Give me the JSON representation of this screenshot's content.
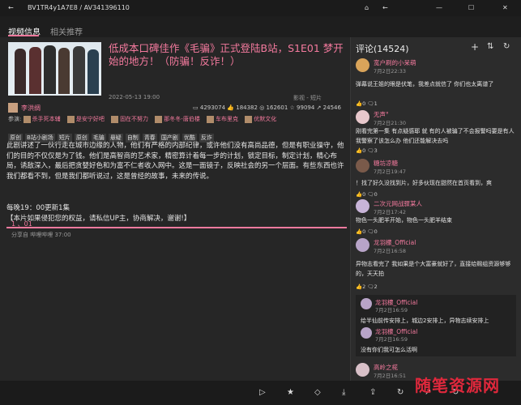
{
  "titlebar": {
    "back": "←",
    "title": "BV1TR4y1A7E8 / AV341396110",
    "home": "⌂",
    "back2": "←",
    "min": "—",
    "max": "☐",
    "close": "✕"
  },
  "tabs": [
    "视频信息",
    "相关推荐"
  ],
  "video": {
    "title": "低成本口碑佳作《毛骗》正式登陆B站，S1E01 梦开始的地方！（防骗！反诈！）",
    "date": "2022-05-13 19:00",
    "category": "影视 - 短片",
    "uploader": "李洪绸",
    "stats": {
      "views": "4293074",
      "likes": "184382",
      "coins": "162601",
      "favorites": "99094",
      "shares": "24546"
    },
    "participants_label": "参演:",
    "participants": [
      "杀手死本辅",
      "是安宁好吧",
      "固在不努力",
      "那冬冬-唐伯楼",
      "车布里克",
      "优默文化"
    ],
    "tags": [
      "原创",
      "B站小剧场",
      "短片",
      "原创",
      "毛骗",
      "悬疑",
      "自制",
      "青春",
      "国产剧",
      "优酷",
      "反诈"
    ],
    "description": "此剧讲述了一伙行走在城市边缘的人物，他们有严格的内部纪律，或许他们没有高尚品德，但是有职业操守，他们的目的不仅仅是为了钱。他们是高智商的艺术家，精密算计着每一步的计划，锁定目标，制定计划，精心布局，诱敌深入，最后把贪婪好色和为富不仁者收入网中。这是一面镜子，反映社会的另一个层面。有些东西也许我们都看不到，但是我们都听说过，这是曾经的故事，未来的传说。",
    "update": "每晚19：00更新1集",
    "rights": "【本片如果侵犯您的权益，请私信UP主，协商解决，谢谢!】",
    "episode": {
      "label": "1 、01",
      "sub": "分享自 哔哩哔哩 37:00"
    }
  },
  "comments": {
    "header": "评论(14524)",
    "items": [
      {
        "name": "宽户刷的小呆萌",
        "time": "7月2日22:33",
        "text": "弹幕说王姐的眼是伏笔，我差点就信了 你们也太离谱了",
        "likes": "0",
        "replies": "1"
      },
      {
        "name": "无声°",
        "time": "7月2日21:30",
        "text": "刚看完第一集 有点疑感耶 就 有的人被骗了不会报警吗要是有人我警察了该怎么办 他们还能解决去吗",
        "likes": "0",
        "replies": "3"
      },
      {
        "name": "糖坊凉糖",
        "time": "7月2日19:47",
        "text": "！找了好久没找到片，好多伙现在甜然在首页看到，爽",
        "likes": "0",
        "replies": "0"
      },
      {
        "name": "二次元网战骤某人",
        "time": "7月2日17:42",
        "text": "物色一头肥羊开始，物色一头肥羊结束",
        "likes": "0",
        "replies": "0"
      },
      {
        "name": "龙羽檬_Official",
        "time": "7月2日16:58",
        "text": "异物志看完了 我如果是个大富豪就好了，直接给赐组资源够够的，天天拍",
        "likes": "2",
        "replies": "2"
      }
    ],
    "replies": [
      {
        "name": "龙羽檬_Official",
        "time": "7月2日16:59",
        "text": "给半仙前传安排上，城边2安排上，异物志续安排上"
      },
      {
        "name": "龙羽檬_Official",
        "time": "7月2日16:59",
        "text": "没有你们我可怎么活啊"
      }
    ],
    "last": {
      "name": "高岭之椛",
      "time": "7月2日16:51"
    }
  },
  "bottombar": [
    "▷",
    "★",
    "◇",
    "⤓",
    "⇪",
    "↻",
    "↗",
    "↻"
  ],
  "watermark": "随笔资源网"
}
